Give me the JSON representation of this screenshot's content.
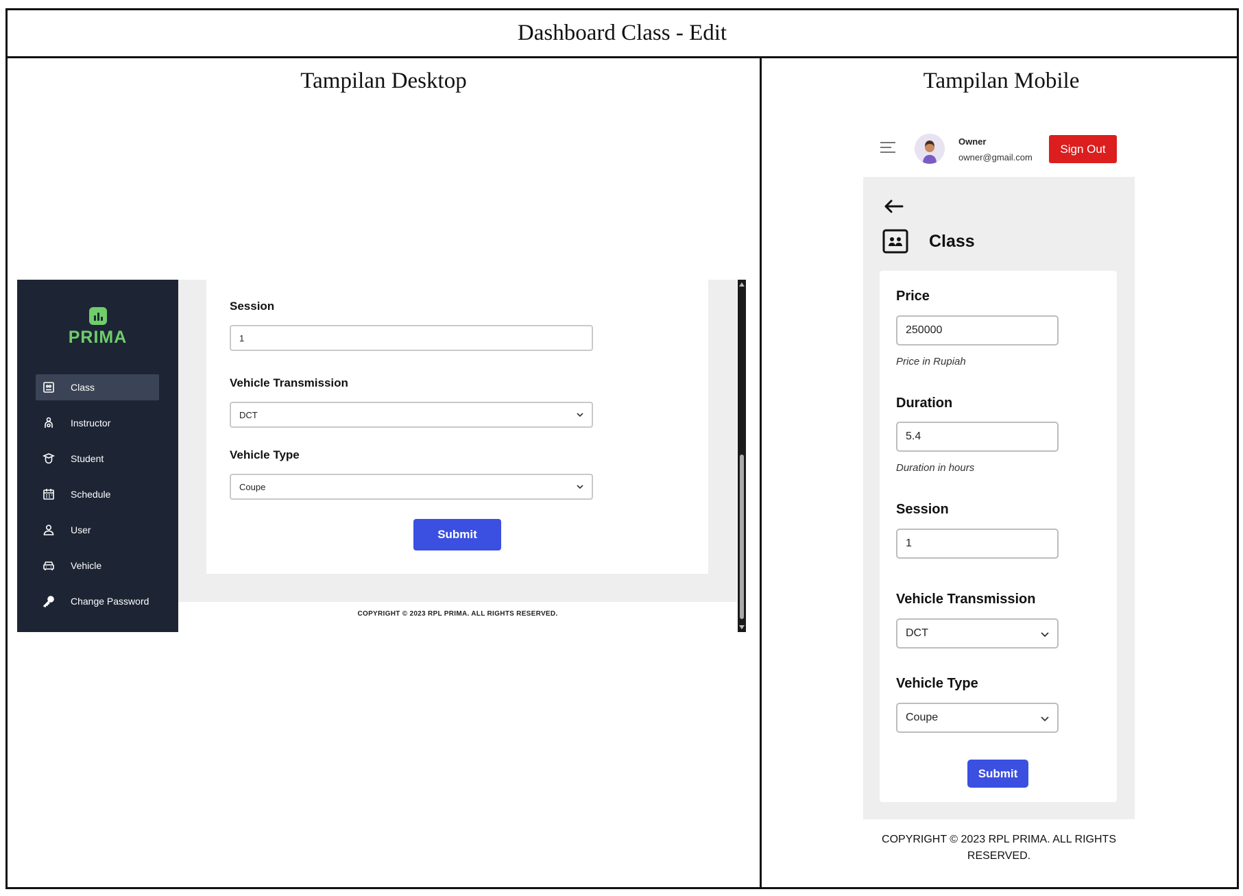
{
  "document": {
    "title": "Dashboard Class - Edit",
    "desktop_heading": "Tampilan Desktop",
    "mobile_heading": "Tampilan Mobile"
  },
  "desktop": {
    "logo_text": "PRIMA",
    "nav": [
      {
        "label": "Class",
        "icon": "class-icon",
        "active": true
      },
      {
        "label": "Instructor",
        "icon": "instructor-icon"
      },
      {
        "label": "Student",
        "icon": "student-icon"
      },
      {
        "label": "Schedule",
        "icon": "schedule-icon"
      },
      {
        "label": "User",
        "icon": "user-icon"
      },
      {
        "label": "Vehicle",
        "icon": "vehicle-icon"
      },
      {
        "label": "Change Password",
        "icon": "key-icon"
      }
    ],
    "form": {
      "session_label": "Session",
      "session_value": "1",
      "transmission_label": "Vehicle Transmission",
      "transmission_value": "DCT",
      "type_label": "Vehicle Type",
      "type_value": "Coupe",
      "submit_label": "Submit"
    },
    "footer": "COPYRIGHT © 2023 RPL PRIMA. ALL RIGHTS RESERVED."
  },
  "mobile": {
    "header": {
      "owner_name": "Owner",
      "owner_email": "owner@gmail.com",
      "signout_label": "Sign Out"
    },
    "page_title": "Class",
    "form": {
      "price_label": "Price",
      "price_value": "250000",
      "price_help": "Price in Rupiah",
      "duration_label": "Duration",
      "duration_value": "5.4",
      "duration_help": "Duration in hours",
      "session_label": "Session",
      "session_value": "1",
      "transmission_label": "Vehicle Transmission",
      "transmission_value": "DCT",
      "type_label": "Vehicle Type",
      "type_value": "Coupe",
      "submit_label": "Submit"
    },
    "footer_line1": "COPYRIGHT © 2023 RPL PRIMA. ALL RIGHTS",
    "footer_line2": "RESERVED."
  },
  "colors": {
    "sidebar_bg": "#1d2535",
    "brand_green": "#6fce6a",
    "primary_button": "#3b4fe0",
    "signout_red": "#dc1e1e",
    "panel_gray": "#eeeeee"
  }
}
